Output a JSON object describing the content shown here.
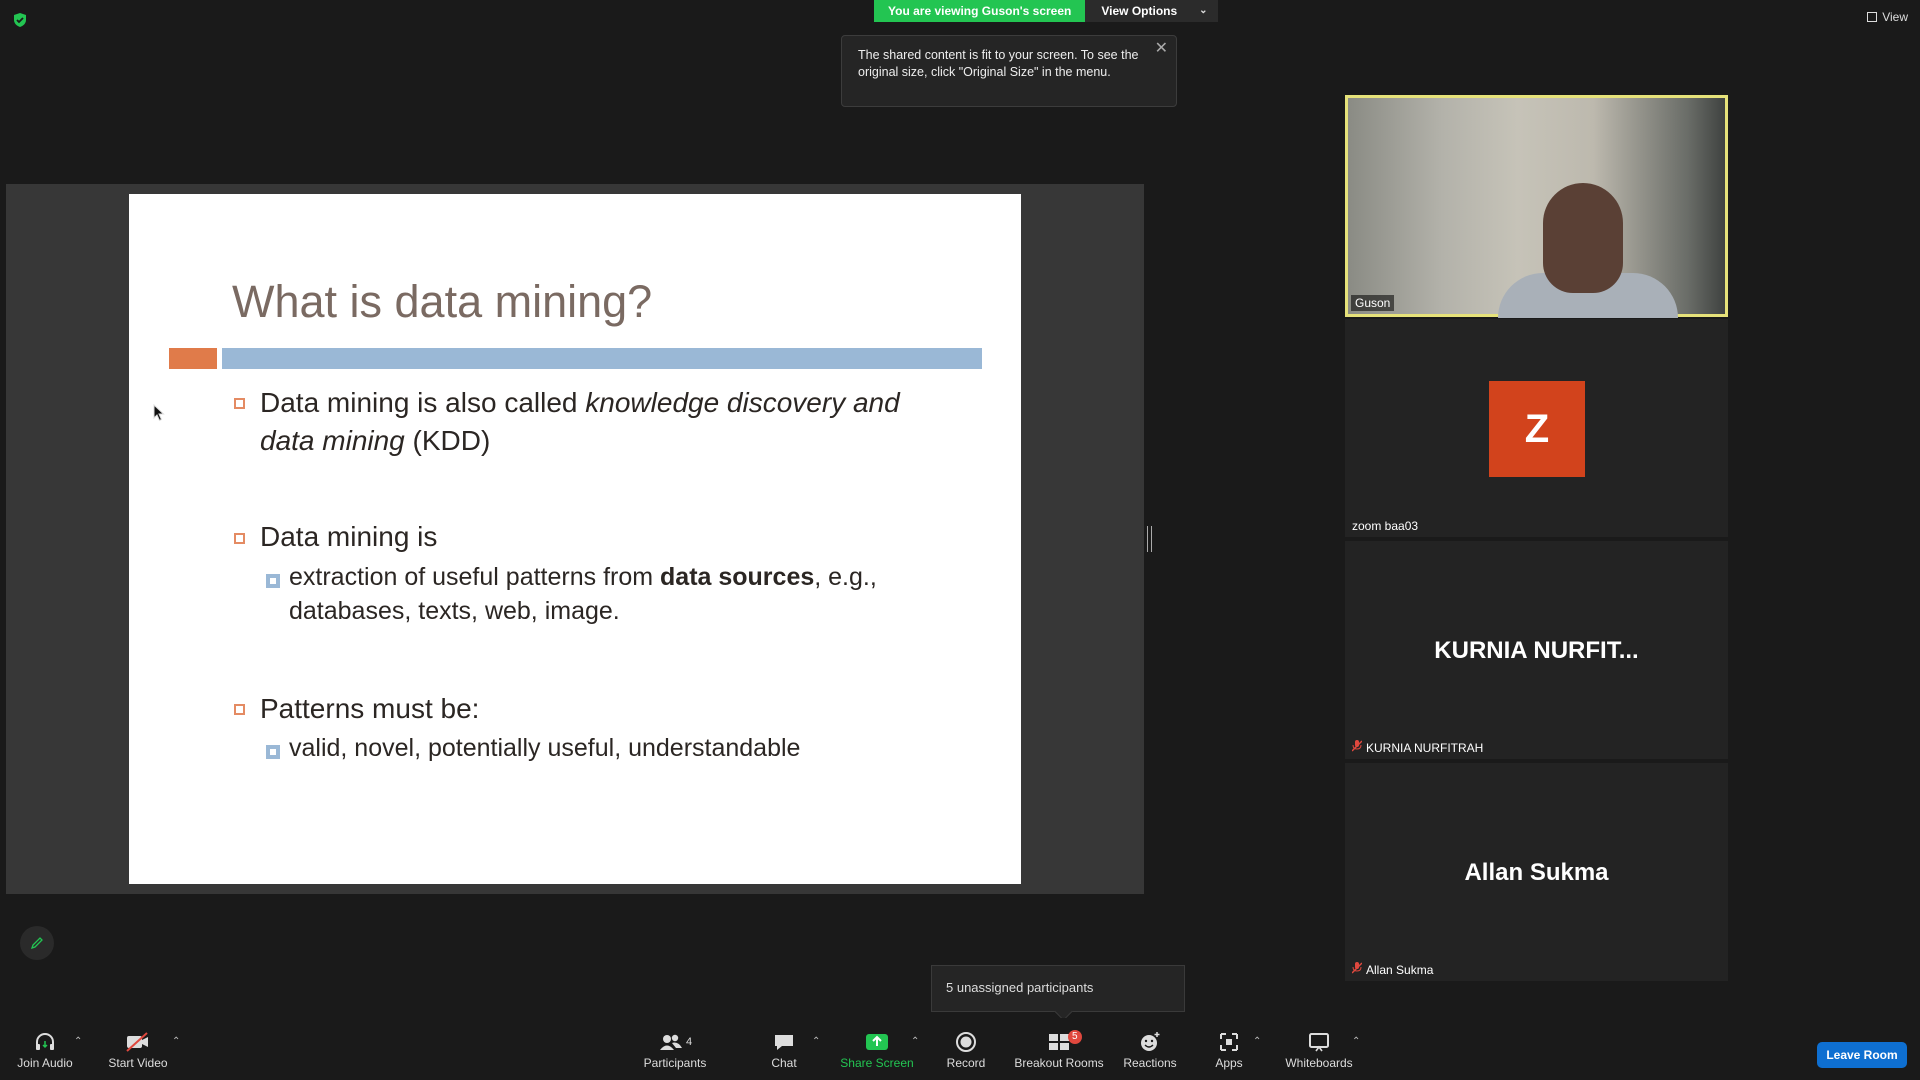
{
  "banner": {
    "viewing_text": "You are viewing Guson's screen",
    "view_options": "View Options"
  },
  "top_right": {
    "view_label": "View"
  },
  "tooltip": {
    "text": "The shared content is fit to your screen. To see the original size, click \"Original Size\" in the menu."
  },
  "slide": {
    "title": "What is data mining?",
    "b1_a": "Data mining is also called ",
    "b1_italic": "knowledge discovery and data mining",
    "b1_b": " (KDD)",
    "b2": "Data mining is",
    "b2_sub_a": "extraction of useful patterns from ",
    "b2_sub_bold": "data sources",
    "b2_sub_b": ", e.g., databases, texts, web, image.",
    "b3": "Patterns must be:",
    "b3_sub": "valid, novel, potentially useful, understandable"
  },
  "participants_tiles": [
    {
      "name": "Guson"
    },
    {
      "name": "zoom baa03",
      "avatar_letter": "Z",
      "avatar_color": "#d2431c"
    },
    {
      "name": "KURNIA NURFITRAH",
      "display": "KURNIA NURFIT..."
    },
    {
      "name": "Allan Sukma",
      "display": "Allan Sukma"
    }
  ],
  "breakout_popup": "5 unassigned participants",
  "toolbar": {
    "join_audio": "Join Audio",
    "start_video": "Start Video",
    "participants": "Participants",
    "participants_count": "4",
    "chat": "Chat",
    "share_screen": "Share Screen",
    "record": "Record",
    "breakout_rooms": "Breakout Rooms",
    "breakout_badge": "5",
    "reactions": "Reactions",
    "apps": "Apps",
    "whiteboards": "Whiteboards",
    "leave": "Leave Room"
  },
  "colors": {
    "share_green": "#23c552",
    "active_speaker": "#e6e27a",
    "leave_blue": "#0e6fd1",
    "muted_red": "#e0483e"
  }
}
